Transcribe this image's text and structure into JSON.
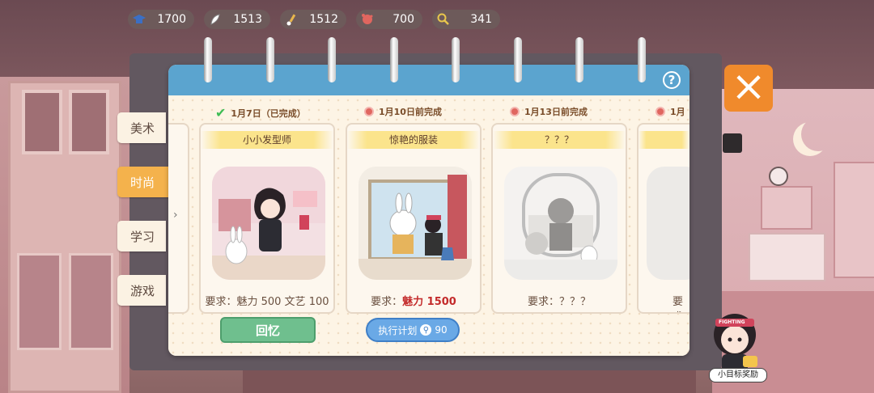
{
  "resources": [
    {
      "icon": "graduation-cap-icon",
      "value": "1700",
      "color": "#3b6fc4"
    },
    {
      "icon": "feather-icon",
      "value": "1513",
      "color": "#ffffff"
    },
    {
      "icon": "paintbrush-icon",
      "value": "1512",
      "color": "#e8b64c"
    },
    {
      "icon": "heart-splat-icon",
      "value": "700",
      "color": "#e0665f"
    },
    {
      "icon": "magnifier-icon",
      "value": "341",
      "color": "#e8c64c"
    }
  ],
  "help_label": "?",
  "close_label": "×",
  "tabs": [
    {
      "label": "美术",
      "active": false
    },
    {
      "label": "时尚",
      "active": true
    },
    {
      "label": "学习",
      "active": false
    },
    {
      "label": "游戏",
      "active": false
    }
  ],
  "cards": [
    {
      "date": "1月7日（已完成）",
      "status": "completed",
      "title": "小小发型师",
      "requirement": "要求：魅力 500 文艺 100",
      "req_prefix": "",
      "req_highlight": ""
    },
    {
      "date": "1月10日前完成",
      "status": "pending",
      "title": "惊艳的服装",
      "requirement": "要求：",
      "req_highlight": "魅力 1500"
    },
    {
      "date": "1月13日前完成",
      "status": "pending",
      "title": "？？？",
      "requirement": "要求：？？？",
      "req_highlight": ""
    },
    {
      "date": "1月",
      "status": "pending",
      "title": "",
      "requirement": "要求",
      "req_highlight": ""
    }
  ],
  "recall_button": "回忆",
  "execute_button": {
    "label": "执行计划",
    "cost": "90",
    "icon": "magnifier-icon"
  },
  "reward_label": "小目标奖励",
  "reward_badge": "FIGHTING"
}
